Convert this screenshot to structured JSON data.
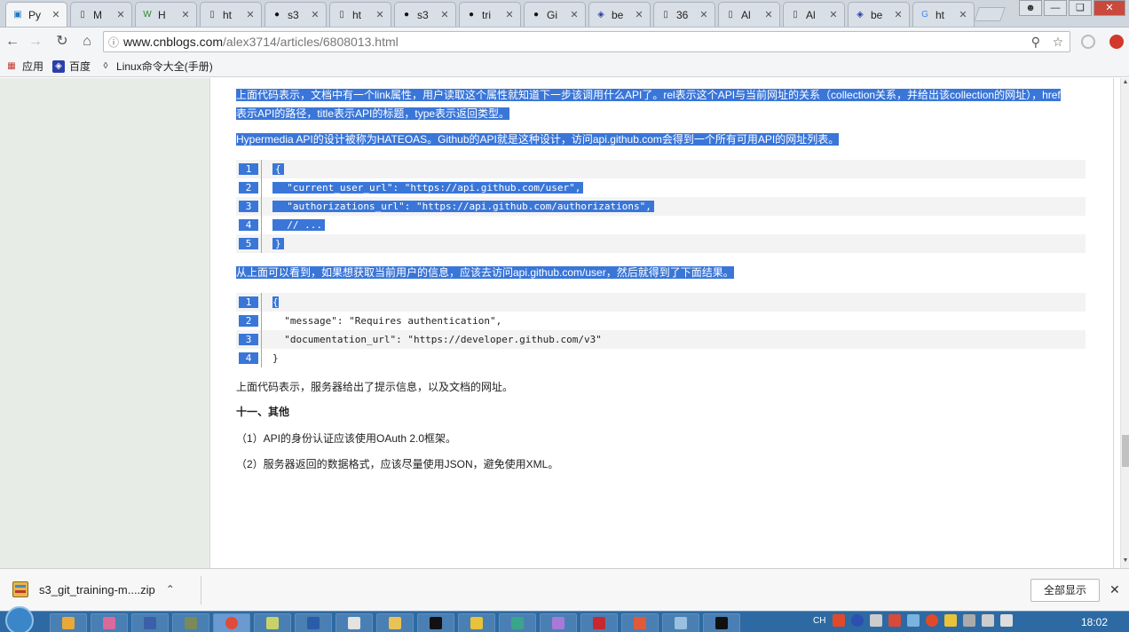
{
  "tabs": [
    {
      "label": "Py",
      "icon": "cnblogs-icon",
      "active": true
    },
    {
      "label": "M",
      "icon": "page-icon"
    },
    {
      "label": "H",
      "icon": "w3-icon"
    },
    {
      "label": "ht",
      "icon": "page-icon"
    },
    {
      "label": "s3",
      "icon": "github-icon"
    },
    {
      "label": "ht",
      "icon": "page-icon"
    },
    {
      "label": "s3",
      "icon": "github-icon"
    },
    {
      "label": "tri",
      "icon": "github-icon"
    },
    {
      "label": "Gi",
      "icon": "github-icon"
    },
    {
      "label": "be",
      "icon": "baidu-icon"
    },
    {
      "label": "36",
      "icon": "page-icon"
    },
    {
      "label": "Al",
      "icon": "page-icon"
    },
    {
      "label": "Al",
      "icon": "page-icon"
    },
    {
      "label": "be",
      "icon": "baidu-icon"
    },
    {
      "label": "ht",
      "icon": "google-icon"
    }
  ],
  "toolbar": {
    "url_host": "www.cnblogs.com",
    "url_path": "/alex3714/articles/6808013.html"
  },
  "bookmarks": [
    {
      "label": "应用",
      "icon": "apps-grid-icon"
    },
    {
      "label": "百度",
      "icon": "baidu-icon"
    },
    {
      "label": "Linux命令大全(手册)",
      "icon": "linux-icon"
    }
  ],
  "article": {
    "p1_line1": "上面代码表示，文档中有一个link属性，用户读取这个属性就知道下一步该调用什么API了。rel表示这个API与当前网址的关系（collection关系，并给出该collection的网址），href",
    "p1_line2": "表示API的路径，title表示API的标题，type表示返回类型。",
    "p2": "Hypermedia API的设计被称为HATEOAS。Github的API就是这种设计，访问api.github.com会得到一个所有可用API的网址列表。",
    "code1": [
      {
        "num": "1",
        "text": "{"
      },
      {
        "num": "2",
        "text": "  \"current_user_url\": \"https://api.github.com/user\","
      },
      {
        "num": "3",
        "text": "  \"authorizations_url\": \"https://api.github.com/authorizations\","
      },
      {
        "num": "4",
        "text": "  // ..."
      },
      {
        "num": "5",
        "text": "}"
      }
    ],
    "p3": "从上面可以看到，如果想获取当前用户的信息，应该去访问api.github.com/user，然后就得到了下面结果。",
    "code2": [
      {
        "num": "1",
        "text": "{"
      },
      {
        "num": "2",
        "text": "  \"message\": \"Requires authentication\","
      },
      {
        "num": "3",
        "text": "  \"documentation_url\": \"https://developer.github.com/v3\""
      },
      {
        "num": "4",
        "text": "}"
      }
    ],
    "p4": "上面代码表示，服务器给出了提示信息，以及文档的网址。",
    "heading": "十一、其他",
    "p5": "（1）API的身份认证应该使用OAuth 2.0框架。",
    "p6": "（2）服务器返回的数据格式，应该尽量使用JSON，避免使用XML。"
  },
  "downloads": {
    "filename": "s3_git_training-m....zip",
    "show_all": "全部显示"
  },
  "taskbar": {
    "input_lang": "CH",
    "clock": "18:02"
  },
  "colors": {
    "selection": "#3a76d8",
    "sidebar_bg": "#e7ede6",
    "taskbar": "#2d6aa3"
  }
}
